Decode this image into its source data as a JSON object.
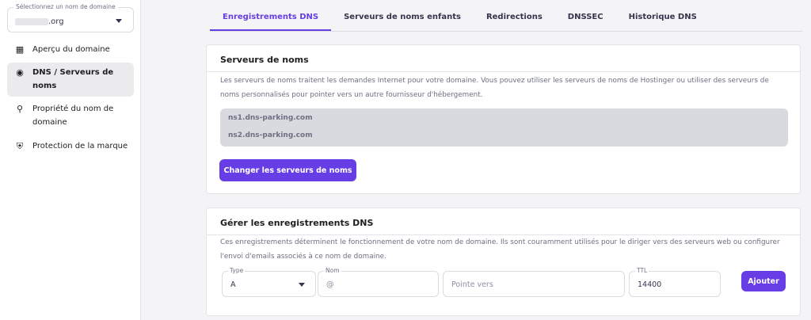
{
  "sidebar": {
    "domain_label": "Sélectionnez un nom de domaine",
    "domain_value": ".org",
    "items": [
      {
        "label": "Aperçu du domaine",
        "icon": "grid-icon"
      },
      {
        "label": "DNS / Serveurs de noms",
        "icon": "dns-icon"
      },
      {
        "label": "Propriété du nom de domaine",
        "icon": "person-icon"
      },
      {
        "label": "Protection de la marque",
        "icon": "shield-icon"
      }
    ]
  },
  "tabs": [
    "Enregistrements DNS",
    "Serveurs de noms enfants",
    "Redirections",
    "DNSSEC",
    "Historique DNS"
  ],
  "nameservers": {
    "title": "Serveurs de noms",
    "description": "Les serveurs de noms traitent les demandes Internet pour votre domaine. Vous pouvez utiliser les serveurs de noms de Hostinger ou utiliser des serveurs de noms personnalisés pour pointer vers un autre fournisseur d'hébergement.",
    "ns": [
      "ns1.dns-parking.com",
      "ns2.dns-parking.com"
    ],
    "button": "Changer les serveurs de noms"
  },
  "records": {
    "title": "Gérer les enregistrements DNS",
    "description": "Ces enregistrements déterminent le fonctionnement de votre nom de domaine. Ils sont couramment utilisés pour le diriger vers des serveurs web ou configurer l'envoi d'emails associés à ce nom de domaine.",
    "type_label": "Type",
    "type_value": "A",
    "name_label": "Nom",
    "name_value": "@",
    "points_placeholder": "Pointe vers",
    "ttl_label": "TTL",
    "ttl_value": "14400",
    "add_button": "Ajouter"
  },
  "colors": {
    "accent": "#673de6"
  }
}
